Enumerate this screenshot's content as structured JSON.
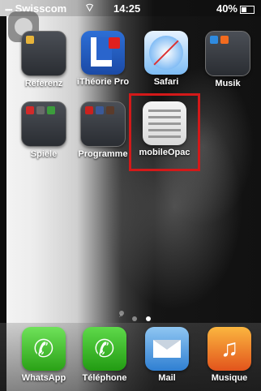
{
  "status_bar": {
    "signal": "••••",
    "carrier": "Swisscom",
    "wifi": "wifi-icon",
    "time": "14:25",
    "battery": "40%"
  },
  "home": {
    "row1": [
      {
        "label": "Referenz",
        "type": "folder"
      },
      {
        "label": "iThéorie Pro",
        "type": "app"
      },
      {
        "label": "Safari",
        "type": "app"
      },
      {
        "label": "Musik",
        "type": "folder"
      }
    ],
    "row2": [
      {
        "label": "Spiele",
        "type": "folder"
      },
      {
        "label": "Programme",
        "type": "folder"
      },
      {
        "label": "mobileOpac",
        "type": "app"
      }
    ]
  },
  "dock": [
    {
      "label": "WhatsApp"
    },
    {
      "label": "Téléphone"
    },
    {
      "label": "Mail"
    },
    {
      "label": "Musique"
    }
  ],
  "page_indicator": {
    "pages": 2,
    "current": 2
  },
  "colors": {
    "highlight": "#d31919"
  }
}
